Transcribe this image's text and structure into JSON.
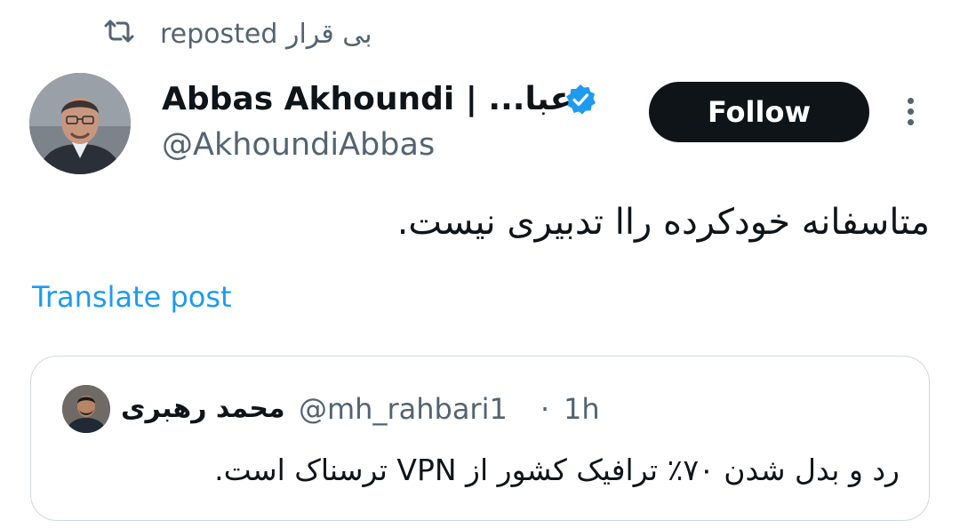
{
  "repost": {
    "label": "reposted بی قرار",
    "icon": "repost-icon"
  },
  "author": {
    "display_name": "Abbas Akhoundi | ...عبا",
    "handle": "@AkhoundiAbbas",
    "verified_icon": "verified-badge-icon",
    "verified_color": "#1d9bf0"
  },
  "actions": {
    "follow_label": "Follow",
    "more_icon": "more-vertical-icon"
  },
  "tweet": {
    "text": "متاسفانه خودکرده راا تدبیری نیست.",
    "translate_label": "Translate post"
  },
  "quote": {
    "name": "محمد رهبری",
    "handle": "@mh_rahbari1",
    "separator": "·",
    "time": "1h",
    "text": "رد و بدل شدن ۷۰٪ ترافیک کشور از VPN ترسناک است."
  },
  "colors": {
    "accent": "#1d9bf0",
    "text_primary": "#0f1419",
    "text_secondary": "#536471",
    "border": "#cfd9de"
  }
}
